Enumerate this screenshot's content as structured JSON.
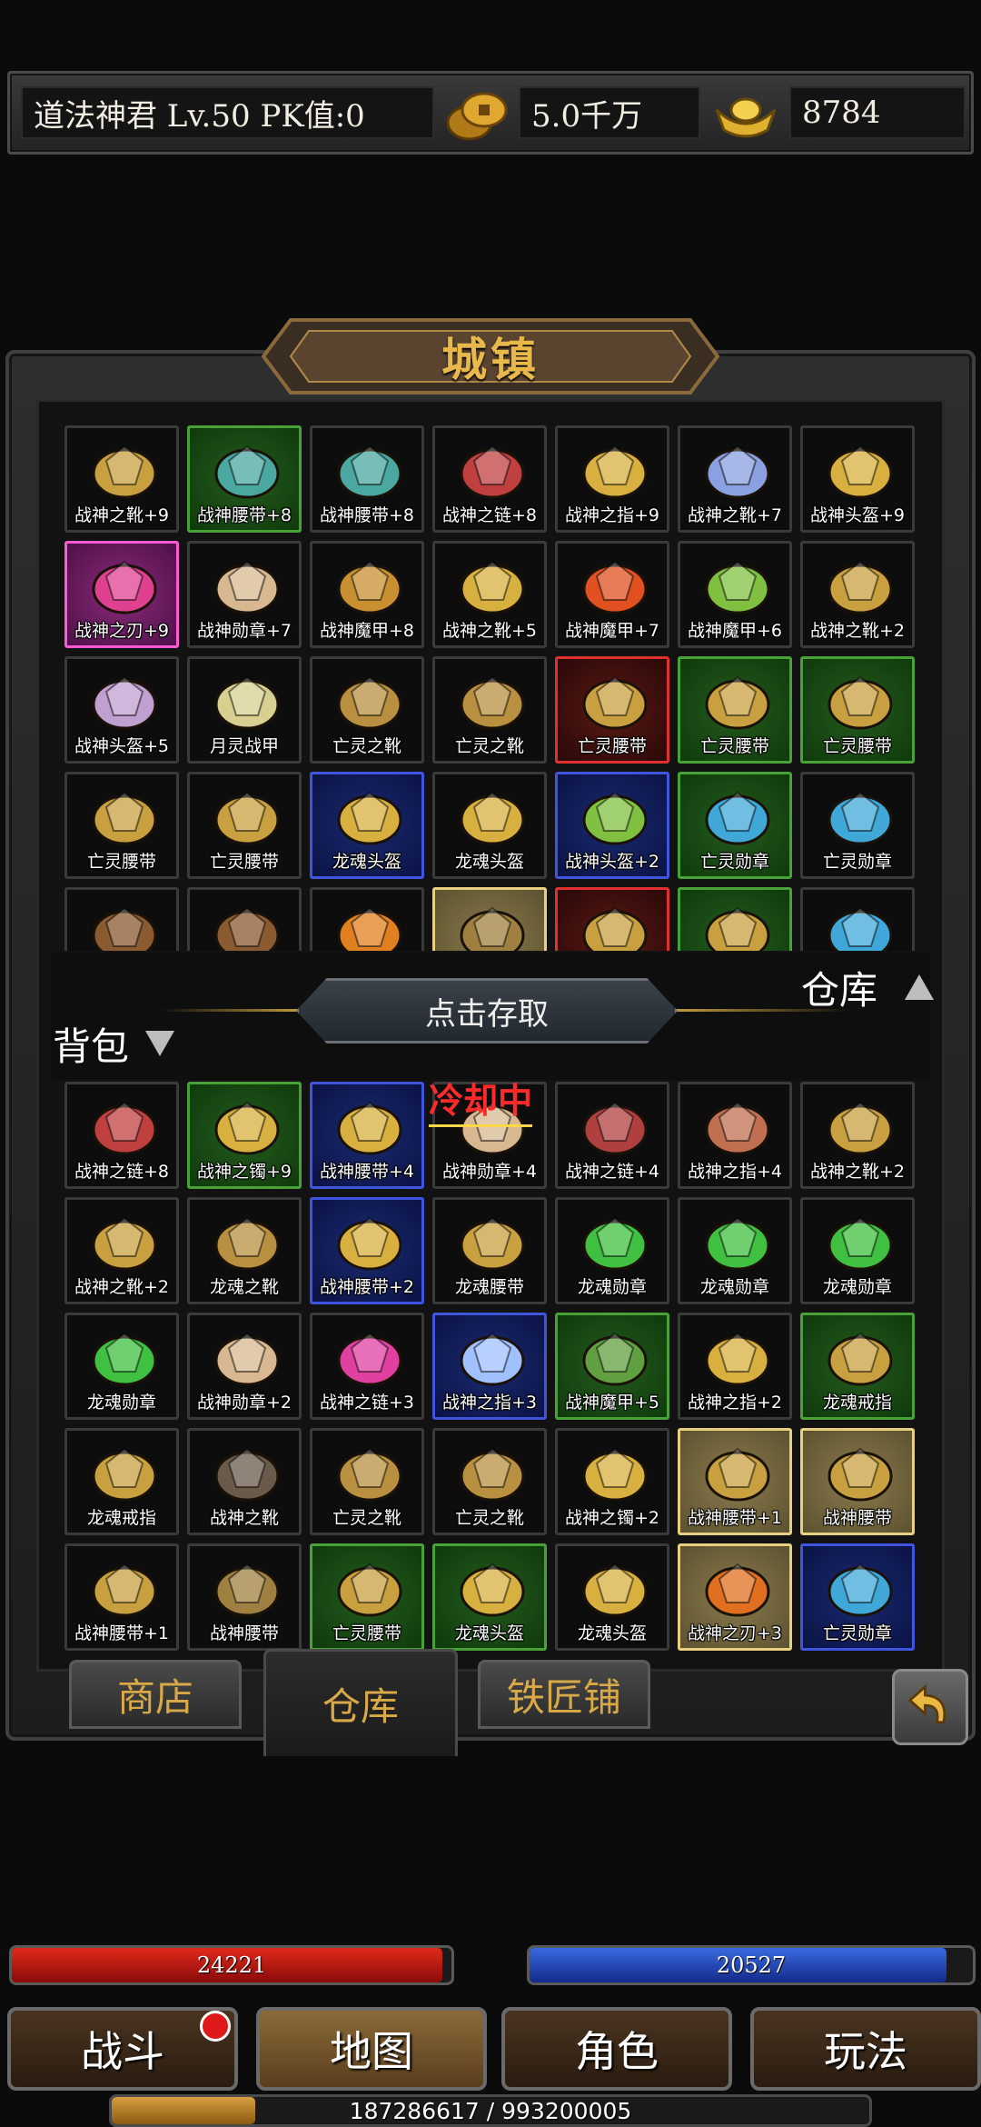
{
  "player": {
    "name_level": "道法神君 Lv.50 PK值:0",
    "gold": "5.0千万",
    "ingot": "8784"
  },
  "panel": {
    "title": "城镇"
  },
  "warehouse": {
    "label": "仓库",
    "access_button": "点击存取",
    "items": [
      {
        "name": "战神之靴+9",
        "quality": "normal",
        "color": "#c9a040"
      },
      {
        "name": "战神腰带+8",
        "quality": "green",
        "color": "#4aa8a0"
      },
      {
        "name": "战神腰带+8",
        "quality": "normal",
        "color": "#4aa8a0"
      },
      {
        "name": "战神之链+8",
        "quality": "normal",
        "color": "#c04040"
      },
      {
        "name": "战神之指+9",
        "quality": "normal",
        "color": "#d8b040"
      },
      {
        "name": "战神之靴+7",
        "quality": "normal",
        "color": "#8aa0e0"
      },
      {
        "name": "战神头盔+9",
        "quality": "normal",
        "color": "#d8b040"
      },
      {
        "name": "战神之刃+9",
        "quality": "pink",
        "color": "#e04090"
      },
      {
        "name": "战神勋章+7",
        "quality": "normal",
        "color": "#d8b890"
      },
      {
        "name": "战神魔甲+8",
        "quality": "normal",
        "color": "#c89030"
      },
      {
        "name": "战神之靴+5",
        "quality": "normal",
        "color": "#d8b040"
      },
      {
        "name": "战神魔甲+7",
        "quality": "normal",
        "color": "#e05020"
      },
      {
        "name": "战神魔甲+6",
        "quality": "normal",
        "color": "#80c040"
      },
      {
        "name": "战神之靴+2",
        "quality": "normal",
        "color": "#c9a040"
      },
      {
        "name": "战神头盔+5",
        "quality": "normal",
        "color": "#c0a0d0"
      },
      {
        "name": "月灵战甲",
        "quality": "normal",
        "color": "#d8d090"
      },
      {
        "name": "亡灵之靴",
        "quality": "normal",
        "color": "#b89040"
      },
      {
        "name": "亡灵之靴",
        "quality": "normal",
        "color": "#b89040"
      },
      {
        "name": "亡灵腰带",
        "quality": "red",
        "color": "#c8a040"
      },
      {
        "name": "亡灵腰带",
        "quality": "green",
        "color": "#c8a040"
      },
      {
        "name": "亡灵腰带",
        "quality": "green",
        "color": "#c8a040"
      },
      {
        "name": "亡灵腰带",
        "quality": "normal",
        "color": "#c8a040"
      },
      {
        "name": "亡灵腰带",
        "quality": "normal",
        "color": "#c8a040"
      },
      {
        "name": "龙魂头盔",
        "quality": "blue",
        "color": "#d8b040"
      },
      {
        "name": "龙魂头盔",
        "quality": "normal",
        "color": "#d8b040"
      },
      {
        "name": "战神头盔+2",
        "quality": "blue",
        "color": "#80c040"
      },
      {
        "name": "亡灵勋章",
        "quality": "green",
        "color": "#40a8d8"
      },
      {
        "name": "亡灵勋章",
        "quality": "normal",
        "color": "#40a8d8"
      },
      {
        "name": "",
        "quality": "normal",
        "color": "#8a5a30"
      },
      {
        "name": "",
        "quality": "normal",
        "color": "#8a5a30"
      },
      {
        "name": "",
        "quality": "normal",
        "color": "#e08020"
      },
      {
        "name": "",
        "quality": "gold",
        "color": "#a08040"
      },
      {
        "name": "",
        "quality": "red",
        "color": "#c8a040"
      },
      {
        "name": "",
        "quality": "green",
        "color": "#c8a040"
      },
      {
        "name": "",
        "quality": "normal",
        "color": "#40a8d8"
      }
    ]
  },
  "bag": {
    "label": "背包",
    "cooldown": "冷却中",
    "items": [
      {
        "name": "战神之链+8",
        "quality": "normal",
        "color": "#c04040"
      },
      {
        "name": "战神之镯+9",
        "quality": "green",
        "color": "#d8b040"
      },
      {
        "name": "战神腰带+4",
        "quality": "blue",
        "color": "#d8b040"
      },
      {
        "name": "战神勋章+4",
        "quality": "normal",
        "color": "#d8b890"
      },
      {
        "name": "战神之链+4",
        "quality": "normal",
        "color": "#b04040"
      },
      {
        "name": "战神之指+4",
        "quality": "normal",
        "color": "#c07050"
      },
      {
        "name": "战神之靴+2",
        "quality": "normal",
        "color": "#c9a040"
      },
      {
        "name": "战神之靴+2",
        "quality": "normal",
        "color": "#c9a040"
      },
      {
        "name": "龙魂之靴",
        "quality": "normal",
        "color": "#b89040"
      },
      {
        "name": "战神腰带+2",
        "quality": "blue",
        "color": "#d8b040"
      },
      {
        "name": "龙魂腰带",
        "quality": "normal",
        "color": "#c8a040"
      },
      {
        "name": "龙魂勋章",
        "quality": "normal",
        "color": "#40c040"
      },
      {
        "name": "龙魂勋章",
        "quality": "normal",
        "color": "#40c040"
      },
      {
        "name": "龙魂勋章",
        "quality": "normal",
        "color": "#40c040"
      },
      {
        "name": "龙魂勋章",
        "quality": "normal",
        "color": "#40c040"
      },
      {
        "name": "战神勋章+2",
        "quality": "normal",
        "color": "#d8b890"
      },
      {
        "name": "战神之链+3",
        "quality": "normal",
        "color": "#e040a0"
      },
      {
        "name": "战神之指+3",
        "quality": "blue",
        "color": "#a0c0ff"
      },
      {
        "name": "战神魔甲+5",
        "quality": "green",
        "color": "#60a040"
      },
      {
        "name": "战神之指+2",
        "quality": "normal",
        "color": "#d8b040"
      },
      {
        "name": "龙魂戒指",
        "quality": "green",
        "color": "#c8a040"
      },
      {
        "name": "龙魂戒指",
        "quality": "normal",
        "color": "#c8a040"
      },
      {
        "name": "战神之靴",
        "quality": "normal",
        "color": "#6a5a4a"
      },
      {
        "name": "亡灵之靴",
        "quality": "normal",
        "color": "#b89040"
      },
      {
        "name": "亡灵之靴",
        "quality": "normal",
        "color": "#b89040"
      },
      {
        "name": "战神之镯+2",
        "quality": "normal",
        "color": "#d8b040"
      },
      {
        "name": "战神腰带+1",
        "quality": "gold",
        "color": "#c8a040"
      },
      {
        "name": "战神腰带",
        "quality": "gold",
        "color": "#c8a040"
      },
      {
        "name": "战神腰带+1",
        "quality": "normal",
        "color": "#c8a040"
      },
      {
        "name": "战神腰带",
        "quality": "normal",
        "color": "#a08040"
      },
      {
        "name": "亡灵腰带",
        "quality": "green",
        "color": "#c8a040"
      },
      {
        "name": "龙魂头盔",
        "quality": "green",
        "color": "#d8b040"
      },
      {
        "name": "龙魂头盔",
        "quality": "normal",
        "color": "#d8b040"
      },
      {
        "name": "战神之刃+3",
        "quality": "gold",
        "color": "#e07020"
      },
      {
        "name": "亡灵勋章",
        "quality": "blue",
        "color": "#40a8d8"
      }
    ]
  },
  "tabs": {
    "shop": "商店",
    "warehouse": "仓库",
    "smith": "铁匠铺"
  },
  "hud": {
    "hp": "24221",
    "hp_fraction": 0.98,
    "mp": "20527",
    "mp_fraction": 0.94,
    "exp": "187286617 / 993200005",
    "exp_fraction": 0.19,
    "nav": {
      "battle": "战斗",
      "map": "地图",
      "role": "角色",
      "play": "玩法"
    }
  }
}
